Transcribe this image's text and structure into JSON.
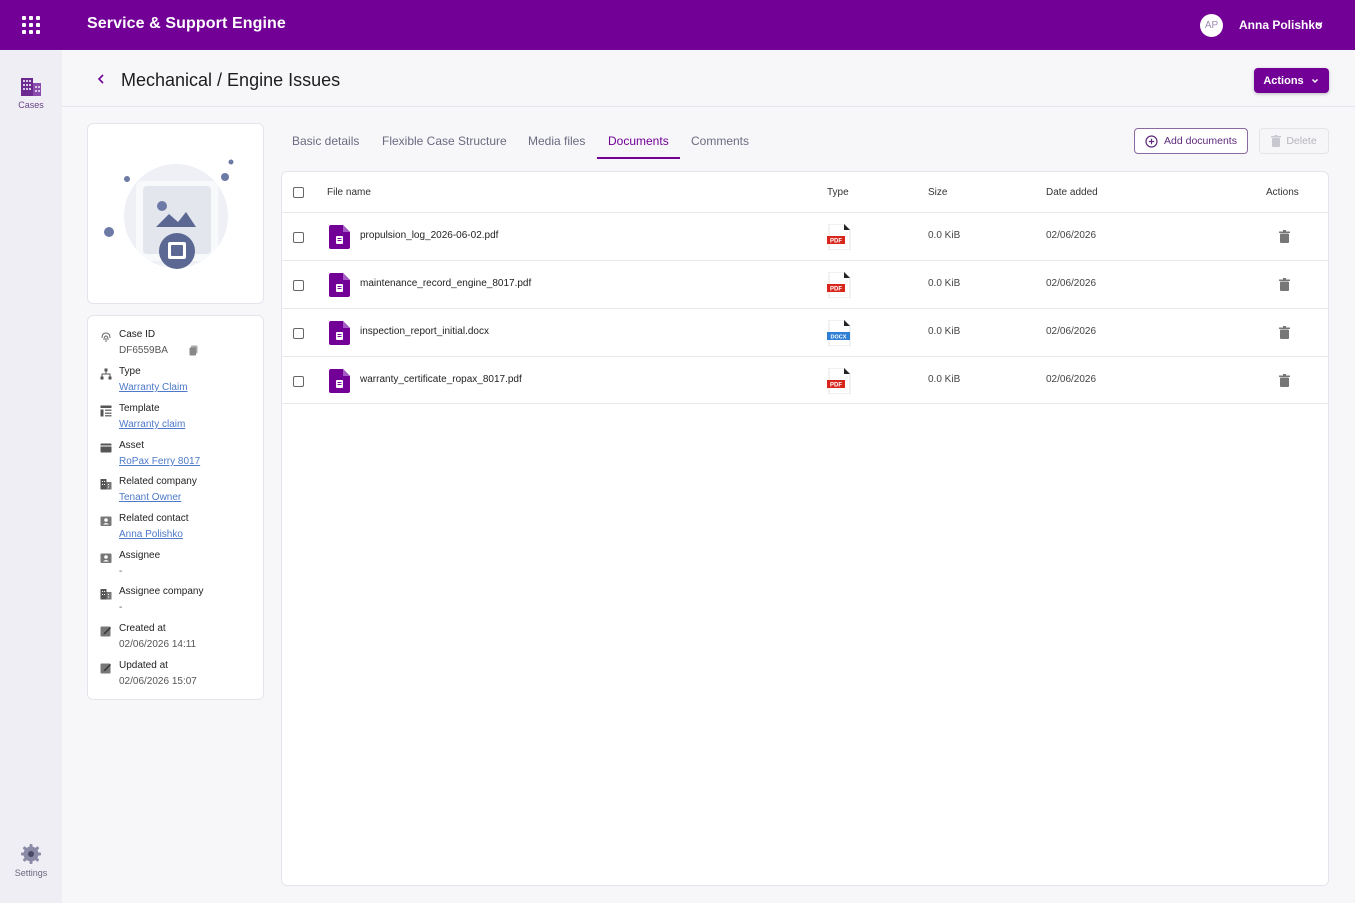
{
  "app": {
    "title": "Service & Support Engine",
    "brand_color": "#720096",
    "grid_icon": "apps-grid-icon"
  },
  "user": {
    "initials": "AP",
    "name": "Anna Polishko"
  },
  "nav": {
    "cases_label": "Cases",
    "settings_label": "Settings"
  },
  "page": {
    "title": "Mechanical / Engine Issues",
    "actions_label": "Actions"
  },
  "info": {
    "case_id_label": "Case ID",
    "case_id_value": "DF6559BA",
    "type_label": "Type",
    "type_value": "Warranty Claim",
    "template_label": "Template",
    "template_value": "Warranty claim",
    "asset_label": "Asset",
    "asset_value": "RoPax Ferry 8017",
    "related_company_label": "Related company",
    "related_company_value": "Tenant Owner",
    "related_contact_label": "Related contact",
    "related_contact_value": "Anna Polishko",
    "assignee_label": "Assignee",
    "assignee_value": "-",
    "assignee_company_label": "Assignee company",
    "assignee_company_value": "-",
    "created_label": "Created at",
    "created_value": "02/06/2026 14:11",
    "updated_label": "Updated at",
    "updated_value": "02/06/2026 15:07"
  },
  "tabs": [
    {
      "label": "Basic details",
      "active": false
    },
    {
      "label": "Flexible Case Structure",
      "active": false
    },
    {
      "label": "Media files",
      "active": false
    },
    {
      "label": "Documents",
      "active": true
    },
    {
      "label": "Comments",
      "active": false
    }
  ],
  "toolbar": {
    "add_label": "Add documents",
    "delete_label": "Delete"
  },
  "table": {
    "headers": {
      "file_name": "File name",
      "type": "Type",
      "size": "Size",
      "date_added": "Date added",
      "actions": "Actions"
    },
    "rows": [
      {
        "file_name": "propulsion_log_2026-06-02.pdf",
        "type": "PDF",
        "size": "0.0 KiB",
        "date_added": "02/06/2026"
      },
      {
        "file_name": "maintenance_record_engine_8017.pdf",
        "type": "PDF",
        "size": "0.0 KiB",
        "date_added": "02/06/2026"
      },
      {
        "file_name": "inspection_report_initial.docx",
        "type": "DOCX",
        "size": "0.0 KiB",
        "date_added": "02/06/2026"
      },
      {
        "file_name": "warranty_certificate_ropax_8017.pdf",
        "type": "PDF",
        "size": "0.0 KiB",
        "date_added": "02/06/2026"
      }
    ]
  }
}
